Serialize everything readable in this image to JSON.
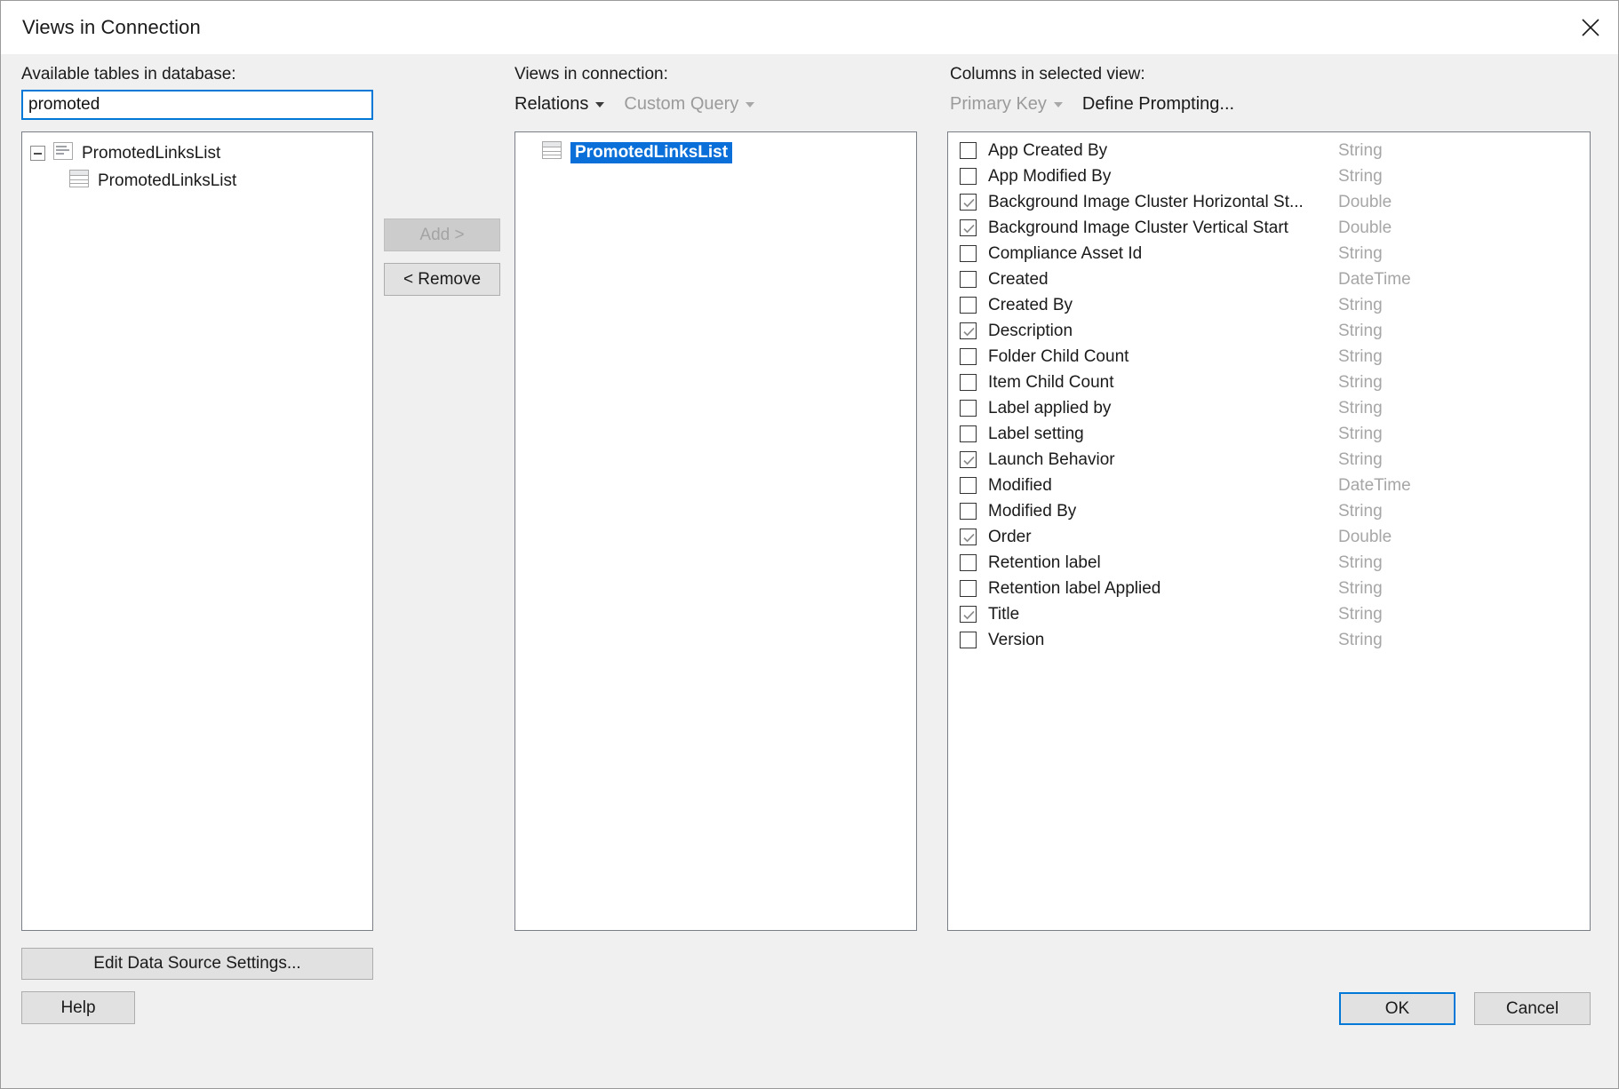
{
  "window": {
    "title": "Views in Connection",
    "close_icon": "close-icon"
  },
  "left": {
    "label": "Available tables in database:",
    "search_value": "promoted",
    "search_placeholder": "",
    "tree": [
      {
        "label": "PromotedLinksList",
        "icon": "view-document-icon",
        "level": 0,
        "expanded": true
      },
      {
        "label": "PromotedLinksList",
        "icon": "table-icon",
        "level": 1,
        "expanded": false
      }
    ],
    "edit_data_source_label": "Edit Data Source Settings...",
    "help_label": "Help"
  },
  "middle": {
    "label": "Views in connection:",
    "menu": [
      {
        "label": "Relations",
        "caret": true,
        "disabled": false
      },
      {
        "label": "Custom Query",
        "caret": true,
        "disabled": true
      }
    ],
    "add_label": "Add >",
    "add_disabled": true,
    "remove_label": "< Remove",
    "remove_disabled": false,
    "views": [
      {
        "label": "PromotedLinksList",
        "icon": "table-icon",
        "selected": true
      }
    ]
  },
  "right": {
    "label": "Columns in selected view:",
    "primary_key_label": "Primary Key",
    "primary_key_disabled": true,
    "define_prompting_label": "Define Prompting...",
    "columns": [
      {
        "name": "App Created By",
        "type": "String",
        "checked": false
      },
      {
        "name": "App Modified By",
        "type": "String",
        "checked": false
      },
      {
        "name": "Background Image Cluster Horizontal St...",
        "type": "Double",
        "checked": true
      },
      {
        "name": "Background Image Cluster Vertical Start",
        "type": "Double",
        "checked": true
      },
      {
        "name": "Compliance Asset Id",
        "type": "String",
        "checked": false
      },
      {
        "name": "Created",
        "type": "DateTime",
        "checked": false
      },
      {
        "name": "Created By",
        "type": "String",
        "checked": false
      },
      {
        "name": "Description",
        "type": "String",
        "checked": true
      },
      {
        "name": "Folder Child Count",
        "type": "String",
        "checked": false
      },
      {
        "name": "Item Child Count",
        "type": "String",
        "checked": false
      },
      {
        "name": "Label applied by",
        "type": "String",
        "checked": false
      },
      {
        "name": "Label setting",
        "type": "String",
        "checked": false
      },
      {
        "name": "Launch Behavior",
        "type": "String",
        "checked": true
      },
      {
        "name": "Modified",
        "type": "DateTime",
        "checked": false
      },
      {
        "name": "Modified By",
        "type": "String",
        "checked": false
      },
      {
        "name": "Order",
        "type": "Double",
        "checked": true
      },
      {
        "name": "Retention label",
        "type": "String",
        "checked": false
      },
      {
        "name": "Retention label Applied",
        "type": "String",
        "checked": false
      },
      {
        "name": "Title",
        "type": "String",
        "checked": true
      },
      {
        "name": "Version",
        "type": "String",
        "checked": false
      }
    ]
  },
  "footer": {
    "ok_label": "OK",
    "cancel_label": "Cancel"
  },
  "colors": {
    "accent": "#0078d7",
    "selection": "#0a6fd8",
    "dialog_bg": "#f0f0f0",
    "panel_border": "#7a7f87",
    "disabled_text": "#a6a6a6"
  }
}
